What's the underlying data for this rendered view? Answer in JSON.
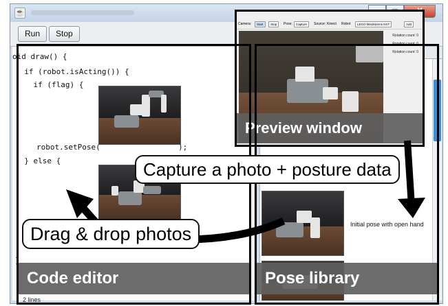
{
  "window": {
    "buttons": {
      "minimize": "–",
      "maximize": "□",
      "close": "X"
    }
  },
  "toolbar": {
    "run_label": "Run",
    "stop_label": "Stop"
  },
  "editor": {
    "lines": [
      "oid draw() {",
      "  if (robot.isActing()) {",
      "    if (flag) {",
      "robot.setPose(",
      ");",
      "  } else {",
      "}"
    ],
    "status": "2 lines"
  },
  "preview": {
    "camera_label": "Camera:",
    "start_label": "Start",
    "stop_label": "Stop",
    "pose_label": "Pose:",
    "capture_label": "Capture",
    "source_label": "Source:",
    "kinect_label": "Kinect",
    "robot_label": "Robot",
    "device_label": "LEGO Mindstorms NXT",
    "add_label": "Add",
    "rotations": [
      "Rotation count: 0",
      "Rotation count: 0",
      "Rotation count: 0"
    ]
  },
  "library": {
    "pose_name": "Initial pose with open hand"
  },
  "annotations": {
    "preview_window": "Preview window",
    "capture_hint": "Capture a photo + posture data",
    "drag_hint": "Drag & drop photos",
    "code_editor": "Code editor",
    "pose_library": "Pose library"
  },
  "colors": {
    "accent_blue": "#3c8ed8",
    "caption_band": "#5f5f5f",
    "close_button": "#c5412b"
  },
  "icons": [
    "java-app-icon",
    "arrow-icon"
  ]
}
